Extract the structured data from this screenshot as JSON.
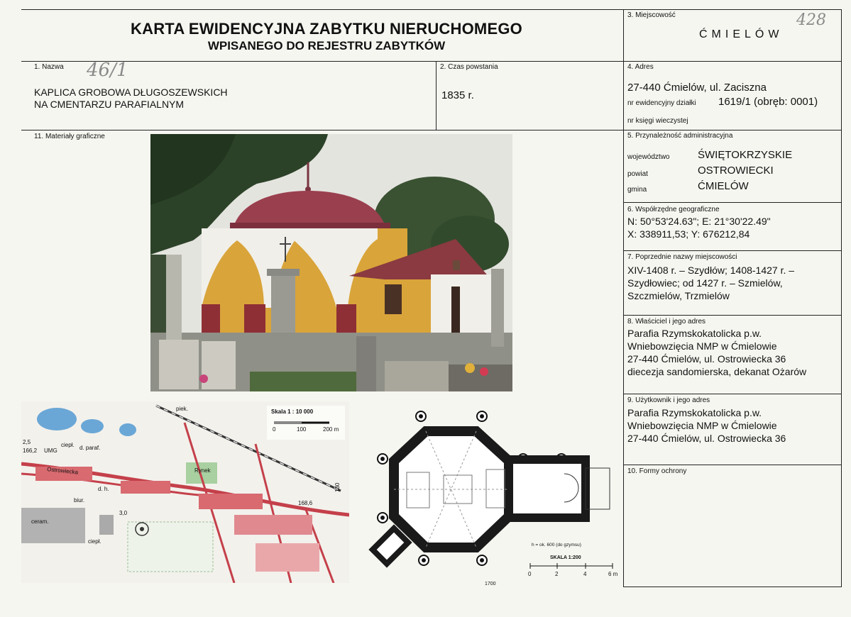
{
  "header": {
    "title_line1": "KARTA EWIDENCYJNA ZABYTKU NIERUCHOMEGO",
    "title_line2": "WPISANEGO DO REJESTRU ZABYTKÓW"
  },
  "handwritten": {
    "corner_number": "428",
    "name_note": "46/1"
  },
  "sections": {
    "place": {
      "label": "3. Miejscowość",
      "value": "ĆMIELÓW"
    },
    "name": {
      "label": "1. Nazwa",
      "line1": "KAPLICA GROBOWA DŁUGOSZEWSKICH",
      "line2": "NA CMENTARZU PARAFIALNYM"
    },
    "created": {
      "label": "2. Czas powstania",
      "value": "1835 r."
    },
    "address": {
      "label": "4. Adres",
      "street": "27-440 Ćmielów, ul. Zaciszna",
      "parcel_label": "nr ewidencyjny działki",
      "parcel_value": "1619/1 (obręb: 0001)",
      "land_register_label": "nr księgi wieczystej"
    },
    "graphics": {
      "label": "11. Materiały graficzne"
    },
    "admin": {
      "label": "5. Przynależność administracyjna",
      "rows": [
        {
          "key": "województwo",
          "value": "ŚWIĘTOKRZYSKIE"
        },
        {
          "key": "powiat",
          "value": "OSTROWIECKI"
        },
        {
          "key": "gmina",
          "value": "ĆMIELÓW"
        }
      ]
    },
    "coords": {
      "label": "6. Współrzędne geograficzne",
      "line1": "N: 50°53'24.63\"; E: 21°30'22.49\"",
      "line2": "X: 338911,53; Y: 676212,84"
    },
    "previous_names": {
      "label": "7. Poprzednie nazwy miejscowości",
      "line1": "XIV-1408 r. – Szydłów; 1408-1427 r. –",
      "line2": "Szydłowiec; od 1427 r. – Szmielów,",
      "line3": "Szczmielów, Trzmielów"
    },
    "owner": {
      "label": "8. Właściciel i jego adres",
      "line1": "Parafia Rzymskokatolicka p.w.",
      "line2": "Wniebowzięcia NMP w Ćmielowie",
      "line3": "27-440 Ćmielów, ul. Ostrowiecka 36",
      "line4": "diecezja sandomierska, dekanat Ożarów"
    },
    "user": {
      "label": "9. Użytkownik i jego adres",
      "line1": "Parafia Rzymskokatolicka p.w.",
      "line2": "Wniebowzięcia NMP w Ćmielowie",
      "line3": "27-440 Ćmielów, ul. Ostrowiecka 36"
    },
    "protection": {
      "label": "10. Formy ochrony"
    }
  },
  "map": {
    "scale_title": "Skala 1 : 10 000",
    "scale_ticks": [
      "0",
      "100",
      "200 m"
    ],
    "labels": {
      "piek": "piek.",
      "umg": "UMG",
      "ciepl": "ciepł.",
      "dparaf": "d. paraf.",
      "ostrowiecka": "Ostrowiecka",
      "rynek": "Rynek",
      "ceram": "ceram.",
      "ciepl2": "ciepł.",
      "biur": "biur.",
      "dh": "d. h.",
      "n1": "2,5",
      "n2": "166,2",
      "n3": "168,6",
      "n4": "130",
      "n5": "3,0"
    }
  },
  "plan": {
    "height_note": "h = ok. 600 (do gzymsu)",
    "scale_title": "SKALA 1:200",
    "scale_ticks": [
      "0",
      "2",
      "4",
      "6 m"
    ],
    "dimension": "1700"
  },
  "colors": {
    "frame": "#222222",
    "dome": "#9a3f4e",
    "wall_yellow": "#d9a43a",
    "wall_white": "#f1efe9",
    "sky": "#e6e6e2",
    "tree": "#2f4a2c",
    "map_red": "#c4404a",
    "map_blue": "#6aa7d6",
    "map_green": "#a8d0a0"
  }
}
